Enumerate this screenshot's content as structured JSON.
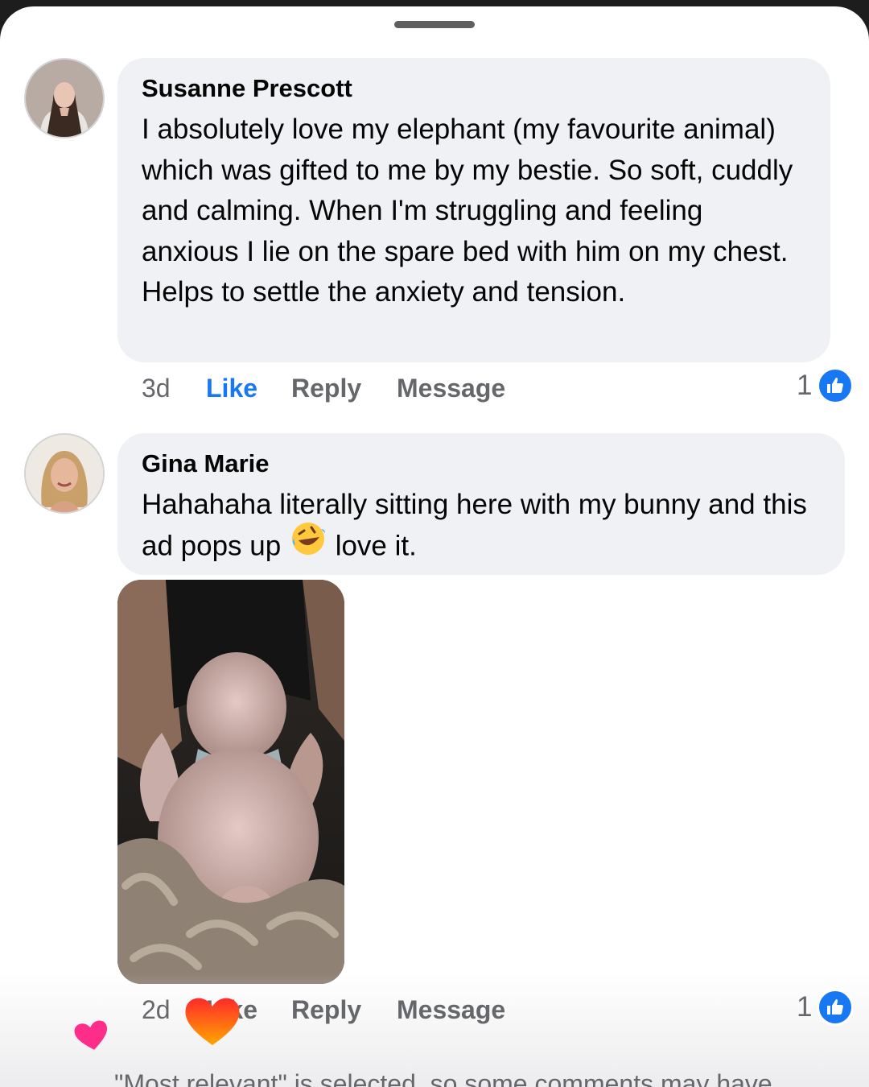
{
  "comments": [
    {
      "author": "Susanne Prescott",
      "text": "I absolutely love my elephant (my favourite animal) which was gifted to me by my bestie. So soft, cuddly and calming. When I'm struggling and feeling anxious I lie on the spare bed with him on my chest. Helps to settle the anxiety and tension.",
      "time": "3d",
      "like_label": "Like",
      "reply_label": "Reply",
      "message_label": "Message",
      "reaction_count": "1",
      "liked": true
    },
    {
      "author": "Gina Marie",
      "text_before_emoji": "Hahahaha literally sitting here with my bunny and this ad pops up",
      "emoji": "rolling-on-floor-laughing-emoji",
      "text_after_emoji": "love it.",
      "time": "2d",
      "like_label": "Like",
      "reply_label": "Reply",
      "message_label": "Message",
      "reaction_count": "1"
    }
  ],
  "footer_notice": "\"Most relevant\" is selected, so some comments may have",
  "colors": {
    "accent": "#1877f2",
    "bubble": "#f0f1f5",
    "meta_text": "#65676b"
  }
}
